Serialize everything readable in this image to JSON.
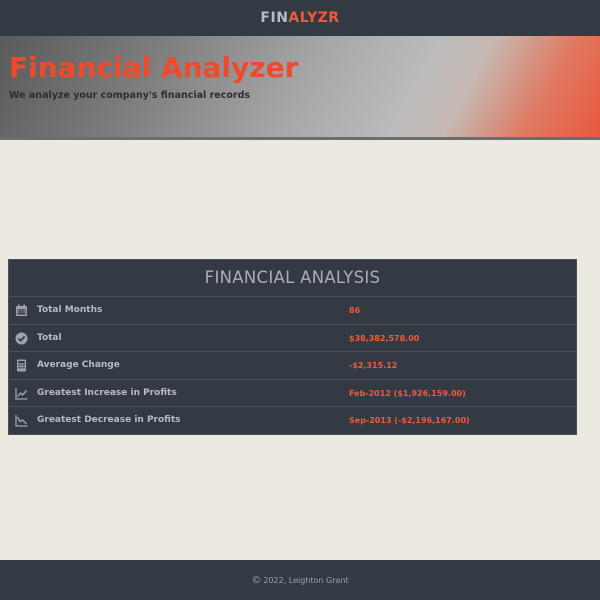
{
  "nav": {
    "brand_part1": "FIN",
    "brand_part2": "ALYZR"
  },
  "hero": {
    "title": "Financial Analyzer",
    "subtitle": "We analyze your company's financial records"
  },
  "analysis": {
    "title": "FINANCIAL ANALYSIS",
    "rows": [
      {
        "icon": "calendar-icon",
        "label": "Total Months",
        "value": "86"
      },
      {
        "icon": "check-circle-icon",
        "label": "Total",
        "value": "$38,382,578.00"
      },
      {
        "icon": "calculator-icon",
        "label": "Average Change",
        "value": "-$2,315.12"
      },
      {
        "icon": "chart-line-up-icon",
        "label": "Greatest Increase in Profits",
        "value": "Feb-2012 ($1,926,159.00)"
      },
      {
        "icon": "chart-line-down-icon",
        "label": "Greatest Decrease in Profits",
        "value": "Sep-2013 (-$2,196,167.00)"
      }
    ]
  },
  "footer": {
    "copyright_symbol": "©",
    "text": "2022, Leighton Grant"
  },
  "colors": {
    "accent": "#f05a3a",
    "dark": "#343a43",
    "background": "#ece9e0"
  }
}
